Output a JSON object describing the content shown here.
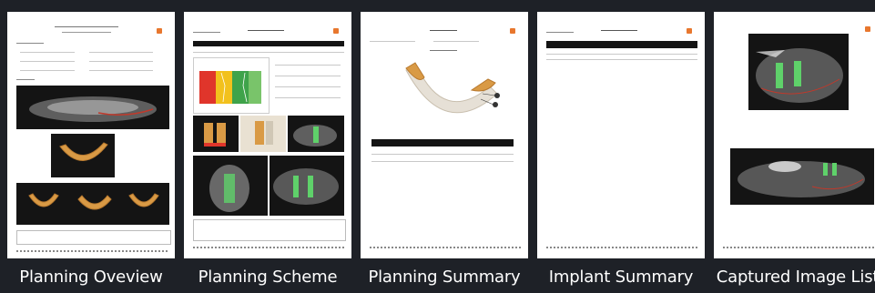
{
  "thumbnails": [
    {
      "label": "Planning Oveview"
    },
    {
      "label": "Planning Scheme"
    },
    {
      "label": "Planning Summary"
    },
    {
      "label": "Implant Summary"
    },
    {
      "label": "Captured Image List"
    }
  ],
  "colors": {
    "background": "#1e2127",
    "page": "#ffffff",
    "accent": "#e8772e",
    "jaw": "#d99a45",
    "implant": "#5fd16a",
    "density_red": "#e0352b",
    "density_yellow": "#f2c11d",
    "density_green": "#3fa34a"
  }
}
